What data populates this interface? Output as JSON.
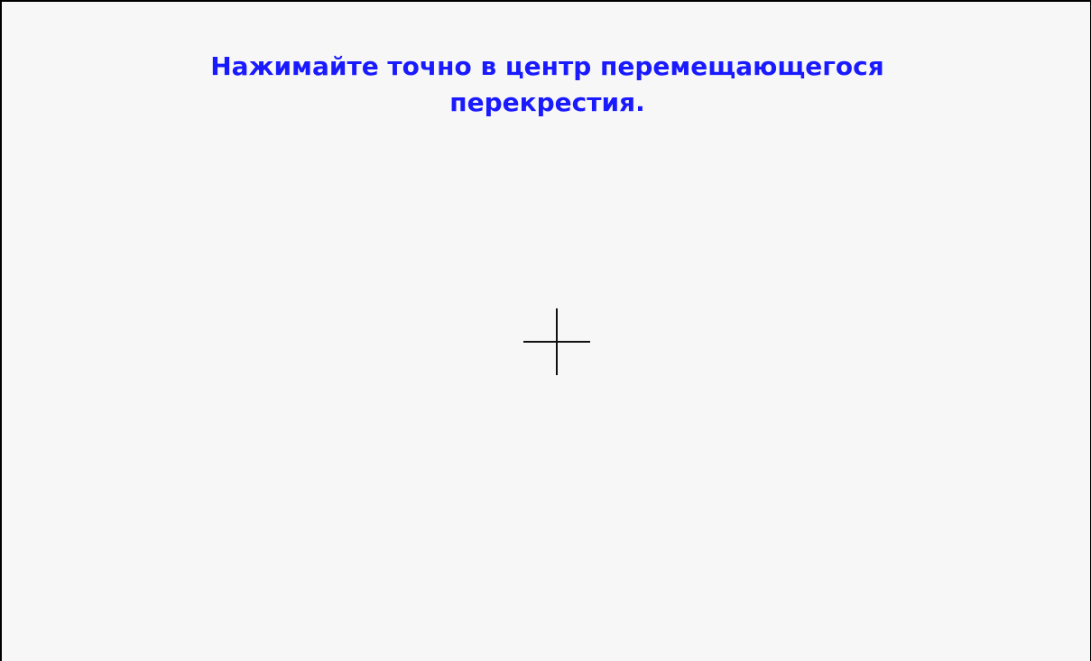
{
  "instruction": {
    "line1": "Нажимайте точно в центр перемещающегося",
    "line2": "перекрестия."
  },
  "target": {
    "icon": "crosshair-icon"
  },
  "colors": {
    "background": "#f7f7f7",
    "instruction_text": "#1a1aff",
    "crosshair": "#111111",
    "border": "#000000"
  }
}
